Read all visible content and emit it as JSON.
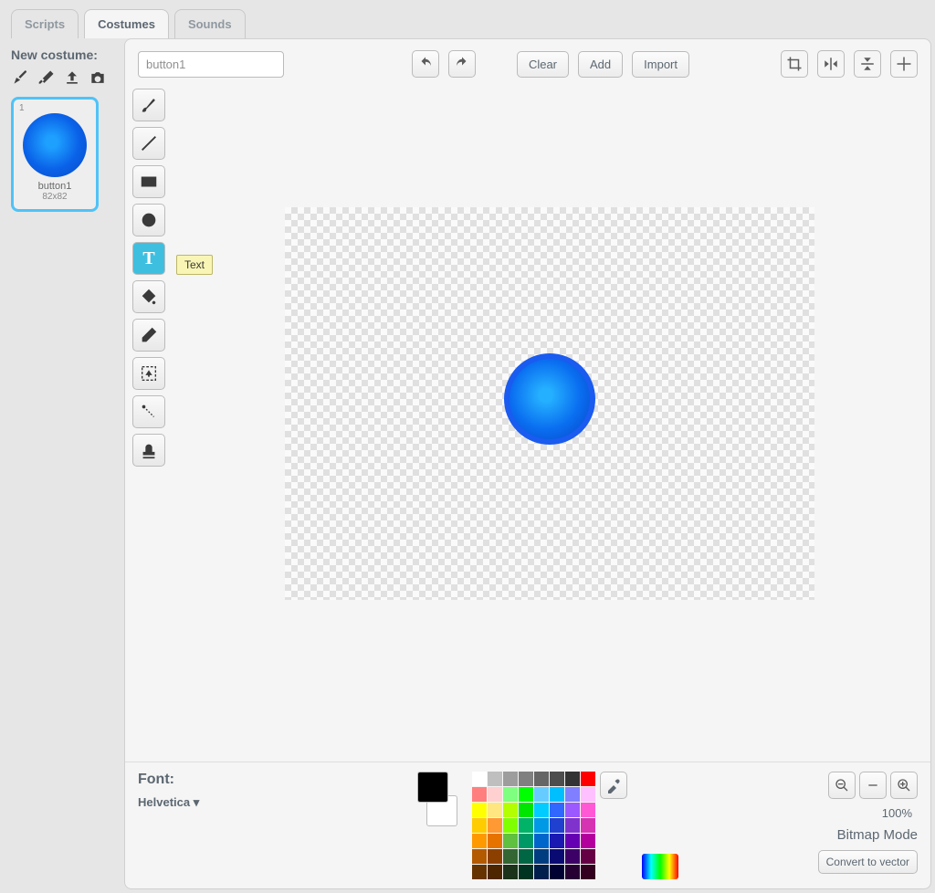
{
  "tabs": {
    "scripts": "Scripts",
    "costumes": "Costumes",
    "sounds": "Sounds"
  },
  "costumePanel": {
    "newLabel": "New costume:",
    "thumbNumber": "1",
    "thumbName": "button1",
    "thumbSize": "82x82"
  },
  "editor": {
    "nameValue": "button1",
    "buttons": {
      "clear": "Clear",
      "add": "Add",
      "import": "Import"
    }
  },
  "tooltip": {
    "text": "Text"
  },
  "bottom": {
    "fontLabel": "Font:",
    "fontName": "Helvetica ▾",
    "zoomPercent": "100%",
    "modeLabel": "Bitmap Mode",
    "convertLabel": "Convert to vector"
  },
  "palette": [
    "#ffffff",
    "#bfbfbf",
    "#9d9d9d",
    "#808080",
    "#666666",
    "#4d4d4d",
    "#333333",
    "#ff0000",
    "#ff7f7f",
    "#ffd0d0",
    "#7fff7f",
    "#00ff00",
    "#66ccff",
    "#00bfff",
    "#7f7fff",
    "#ffc0ff",
    "#ffff00",
    "#ffe680",
    "#b3ff00",
    "#00e600",
    "#00ccff",
    "#3068ff",
    "#9b59ff",
    "#ff59d6",
    "#ffcc00",
    "#ff9933",
    "#80ff00",
    "#00b366",
    "#0099e6",
    "#2040d0",
    "#8033cc",
    "#d633b3",
    "#ff9900",
    "#e67300",
    "#60c040",
    "#009966",
    "#0066cc",
    "#1a1ab3",
    "#6600b3",
    "#b3009d",
    "#b35900",
    "#8c4000",
    "#336633",
    "#006644",
    "#003d80",
    "#0a0a73",
    "#3d0066",
    "#660045",
    "#663300",
    "#4d2600",
    "#1a331a",
    "#003322",
    "#001f4d",
    "#000033",
    "#260033",
    "#33001f"
  ]
}
